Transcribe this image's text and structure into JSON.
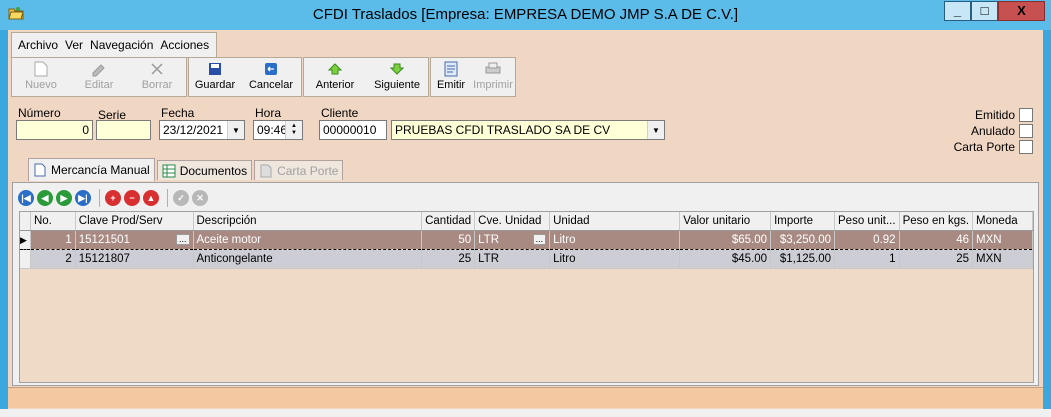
{
  "window": {
    "title": "CFDI Traslados [Empresa: EMPRESA DEMO JMP S.A DE C.V.]",
    "minimize": "_",
    "maximize": "□",
    "close": "X"
  },
  "menu": {
    "archivo": "Archivo",
    "ver": "Ver",
    "navegacion": "Navegación",
    "acciones": "Acciones"
  },
  "toolbar": {
    "nuevo": "Nuevo",
    "editar": "Editar",
    "borrar": "Borrar",
    "guardar": "Guardar",
    "cancelar": "Cancelar",
    "anterior": "Anterior",
    "siguiente": "Siguiente",
    "emitir": "Emitir",
    "imprimir": "Imprimir"
  },
  "form": {
    "numero_label": "Número",
    "numero_value": "0",
    "serie_label": "Serie",
    "serie_value": "",
    "fecha_label": "Fecha",
    "fecha_value": "23/12/2021",
    "hora_label": "Hora",
    "hora_value": "09:46",
    "cliente_label": "Cliente",
    "cliente_code": "00000010",
    "cliente_name": "PRUEBAS CFDI TRASLADO SA DE CV",
    "emitido_label": "Emitido",
    "anulado_label": "Anulado",
    "carta_porte_label": "Carta Porte"
  },
  "tabs": {
    "mercancia": "Mercancía Manual",
    "documentos": "Documentos",
    "carta_porte": "Carta Porte"
  },
  "grid": {
    "headers": [
      "No.",
      "Clave Prod/Serv",
      "Descripción",
      "Cantidad",
      "Cve. Unidad",
      "Unidad",
      "Valor unitario",
      "Importe",
      "Peso unit...",
      "Peso en kgs.",
      "Moneda"
    ],
    "rows": [
      {
        "no": "1",
        "clave": "15121501",
        "descripcion": "Aceite motor",
        "cantidad": "50",
        "cve_unidad": "LTR",
        "unidad": "Litro",
        "valor_unitario": "$65.00",
        "importe": "$3,250.00",
        "peso_unit": "0.92",
        "peso_kgs": "46",
        "moneda": "MXN"
      },
      {
        "no": "2",
        "clave": "15121807",
        "descripcion": "Anticongelante",
        "cantidad": "25",
        "cve_unidad": "LTR",
        "unidad": "Litro",
        "valor_unitario": "$45.00",
        "importe": "$1,125.00",
        "peso_unit": "1",
        "peso_kgs": "25",
        "moneda": "MXN"
      }
    ],
    "ellipsis": "..."
  }
}
